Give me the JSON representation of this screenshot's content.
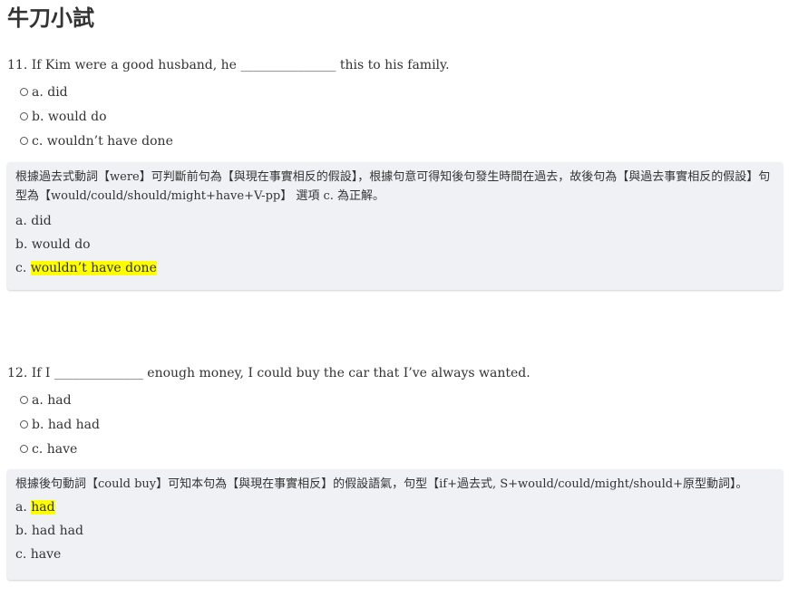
{
  "page": {
    "title": "牛刀小試"
  },
  "questions": [
    {
      "text": "11. If Kim were a good husband, he _______________ this to his family.",
      "options": [
        "a. did",
        "b. would do",
        "c. wouldn’t have done"
      ],
      "explanation": {
        "text": "根據過去式動詞【were】可判斷前句為【與現在事實相反的假設】，根據句意可得知後句發生時間在過去，故後句為【與過去事實相反的假設】句型為【would/could/should/might+have+V-pp】 選項 c. 為正解。",
        "answers": [
          {
            "prefix": "a. ",
            "text": "did"
          },
          {
            "prefix": "b. ",
            "text": "would do"
          },
          {
            "prefix": "c. ",
            "text": "wouldn’t have done"
          }
        ],
        "correct_index": 2
      }
    },
    {
      "text": "12. If I ______________ enough money, I could buy the car that I’ve always wanted.",
      "options": [
        "a. had",
        "b. had had",
        "c. have"
      ],
      "explanation": {
        "text": "根據後句動詞【could buy】可知本句為【與現在事實相反】的假設語氣，句型【if+過去式, S+would/could/might/should+原型動詞】。",
        "answers": [
          {
            "prefix": "a. ",
            "text": "had"
          },
          {
            "prefix": "b. ",
            "text": "had had"
          },
          {
            "prefix": "c. ",
            "text": "have"
          }
        ],
        "correct_index": 0
      }
    }
  ],
  "colors": {
    "highlight": "#ffff00",
    "explanation_bg": "#f0f1f5",
    "text": "#333333"
  }
}
